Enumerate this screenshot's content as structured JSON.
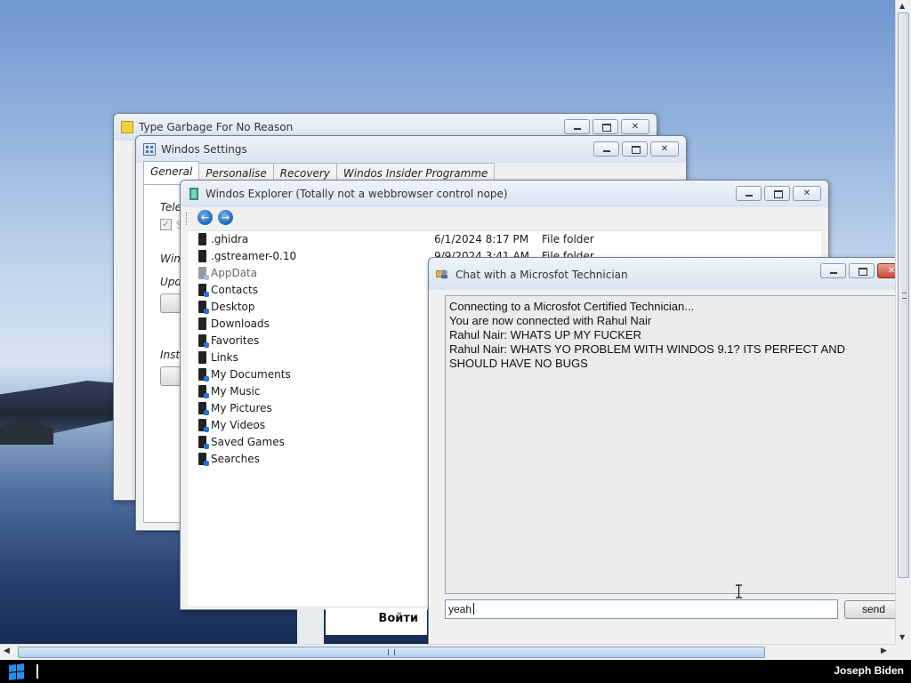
{
  "garbage_window": {
    "title": "Type Garbage For No Reason"
  },
  "settings_window": {
    "title": "Windos Settings",
    "tabs": [
      "General",
      "Personalise",
      "Recovery",
      "Windos Insider Programme"
    ],
    "labels": {
      "telemetry": "Tele",
      "checkbox_text": "S",
      "windos": "Win",
      "updates": "Upd",
      "install": "Insto"
    }
  },
  "explorer_window": {
    "title": "Windos Explorer (Totally not a webbrowser control nope)",
    "back_icon": "back-arrow-icon",
    "forward_icon": "forward-arrow-icon",
    "files": [
      {
        "name": ".ghidra",
        "date": "6/1/2024 8:17 PM",
        "type": "File folder"
      },
      {
        "name": ".gstreamer-0.10",
        "date": "9/9/2024 3:41 AM",
        "type": "File folder"
      },
      {
        "name": "AppData",
        "date": "",
        "type": ""
      },
      {
        "name": "Contacts",
        "date": "",
        "type": ""
      },
      {
        "name": "Desktop",
        "date": "",
        "type": ""
      },
      {
        "name": "Downloads",
        "date": "",
        "type": ""
      },
      {
        "name": "Favorites",
        "date": "",
        "type": ""
      },
      {
        "name": "Links",
        "date": "",
        "type": ""
      },
      {
        "name": "My Documents",
        "date": "",
        "type": ""
      },
      {
        "name": "My Music",
        "date": "",
        "type": ""
      },
      {
        "name": "My Pictures",
        "date": "",
        "type": ""
      },
      {
        "name": "My Videos",
        "date": "",
        "type": ""
      },
      {
        "name": "Saved Games",
        "date": "",
        "type": ""
      },
      {
        "name": "Searches",
        "date": "",
        "type": ""
      }
    ]
  },
  "login": {
    "button_label": "Войти"
  },
  "chat_window": {
    "title": "Chat with a Microsfot Technician",
    "messages": [
      "Connecting to a Microsfot Certified Technician...",
      "You are now connected with Rahul Nair",
      "Rahul Nair: WHATS UP MY FUCKER",
      "Rahul Nair: WHATS YO PROBLEM WITH WINDOS 9.1? ITS PERFECT AND SHOULD HAVE NO BUGS"
    ],
    "input_value": "yeah",
    "send_label": "send"
  },
  "taskbar": {
    "start_icon": "windows-logo-icon",
    "username": "Joseph Biden"
  },
  "colors": {
    "accent": "#2a8ee8",
    "taskbar": "#000000",
    "close_red": "#c74a36"
  }
}
